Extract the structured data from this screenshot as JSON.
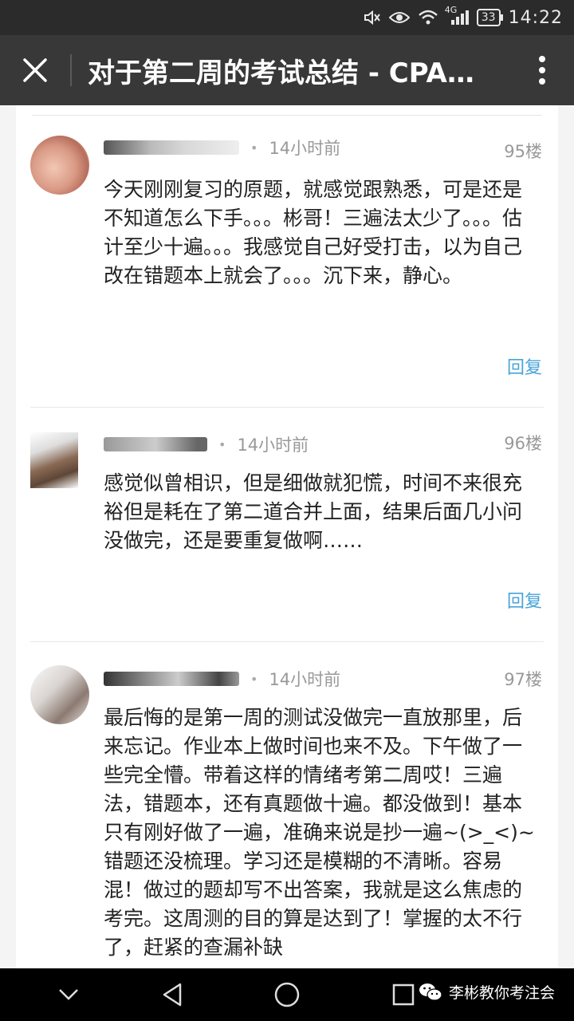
{
  "status_bar": {
    "network": "4G",
    "battery": "33",
    "time": "14:22"
  },
  "header": {
    "title": "对于第二周的考试总结 - CPA…"
  },
  "comments": [
    {
      "time": "14小时前",
      "floor": "95楼",
      "text": "今天刚刚复习的原题，就感觉跟熟悉，可是还是不知道怎么下手。。。彬哥！三遍法太少了。。。估计至少十遍。。。我感觉自己好受打击，以为自己改在错题本上就会了。。。沉下来，静心。",
      "reply": "回复"
    },
    {
      "time": "14小时前",
      "floor": "96楼",
      "text": "感觉似曾相识，但是细做就犯慌，时间不来很充裕但是耗在了第二道合并上面，结果后面几小问没做完，还是要重复做啊……",
      "reply": "回复"
    },
    {
      "time": "14小时前",
      "floor": "97楼",
      "text": "最后悔的是第一周的测试没做完一直放那里，后来忘记。作业本上做时间也来不及。下午做了一些完全懵。带着这样的情绪考第二周哎！三遍法，错题本，还有真题做十遍。都没做到！基本只有刚好做了一遍，准确来说是抄一遍~(>_<)~错题还没梳理。学习还是模糊的不清晰。容易混！做过的题却写不出答案，我就是这么焦虑的考完。这周测的目的算是达到了！掌握的太不行了，赶紧的查漏补缺"
    }
  ],
  "watermark": {
    "text": "李彬教你考注会"
  },
  "colors": {
    "reply": "#4aa3d8",
    "title_bar": "#383838",
    "status_bar": "#2b2b2b"
  }
}
